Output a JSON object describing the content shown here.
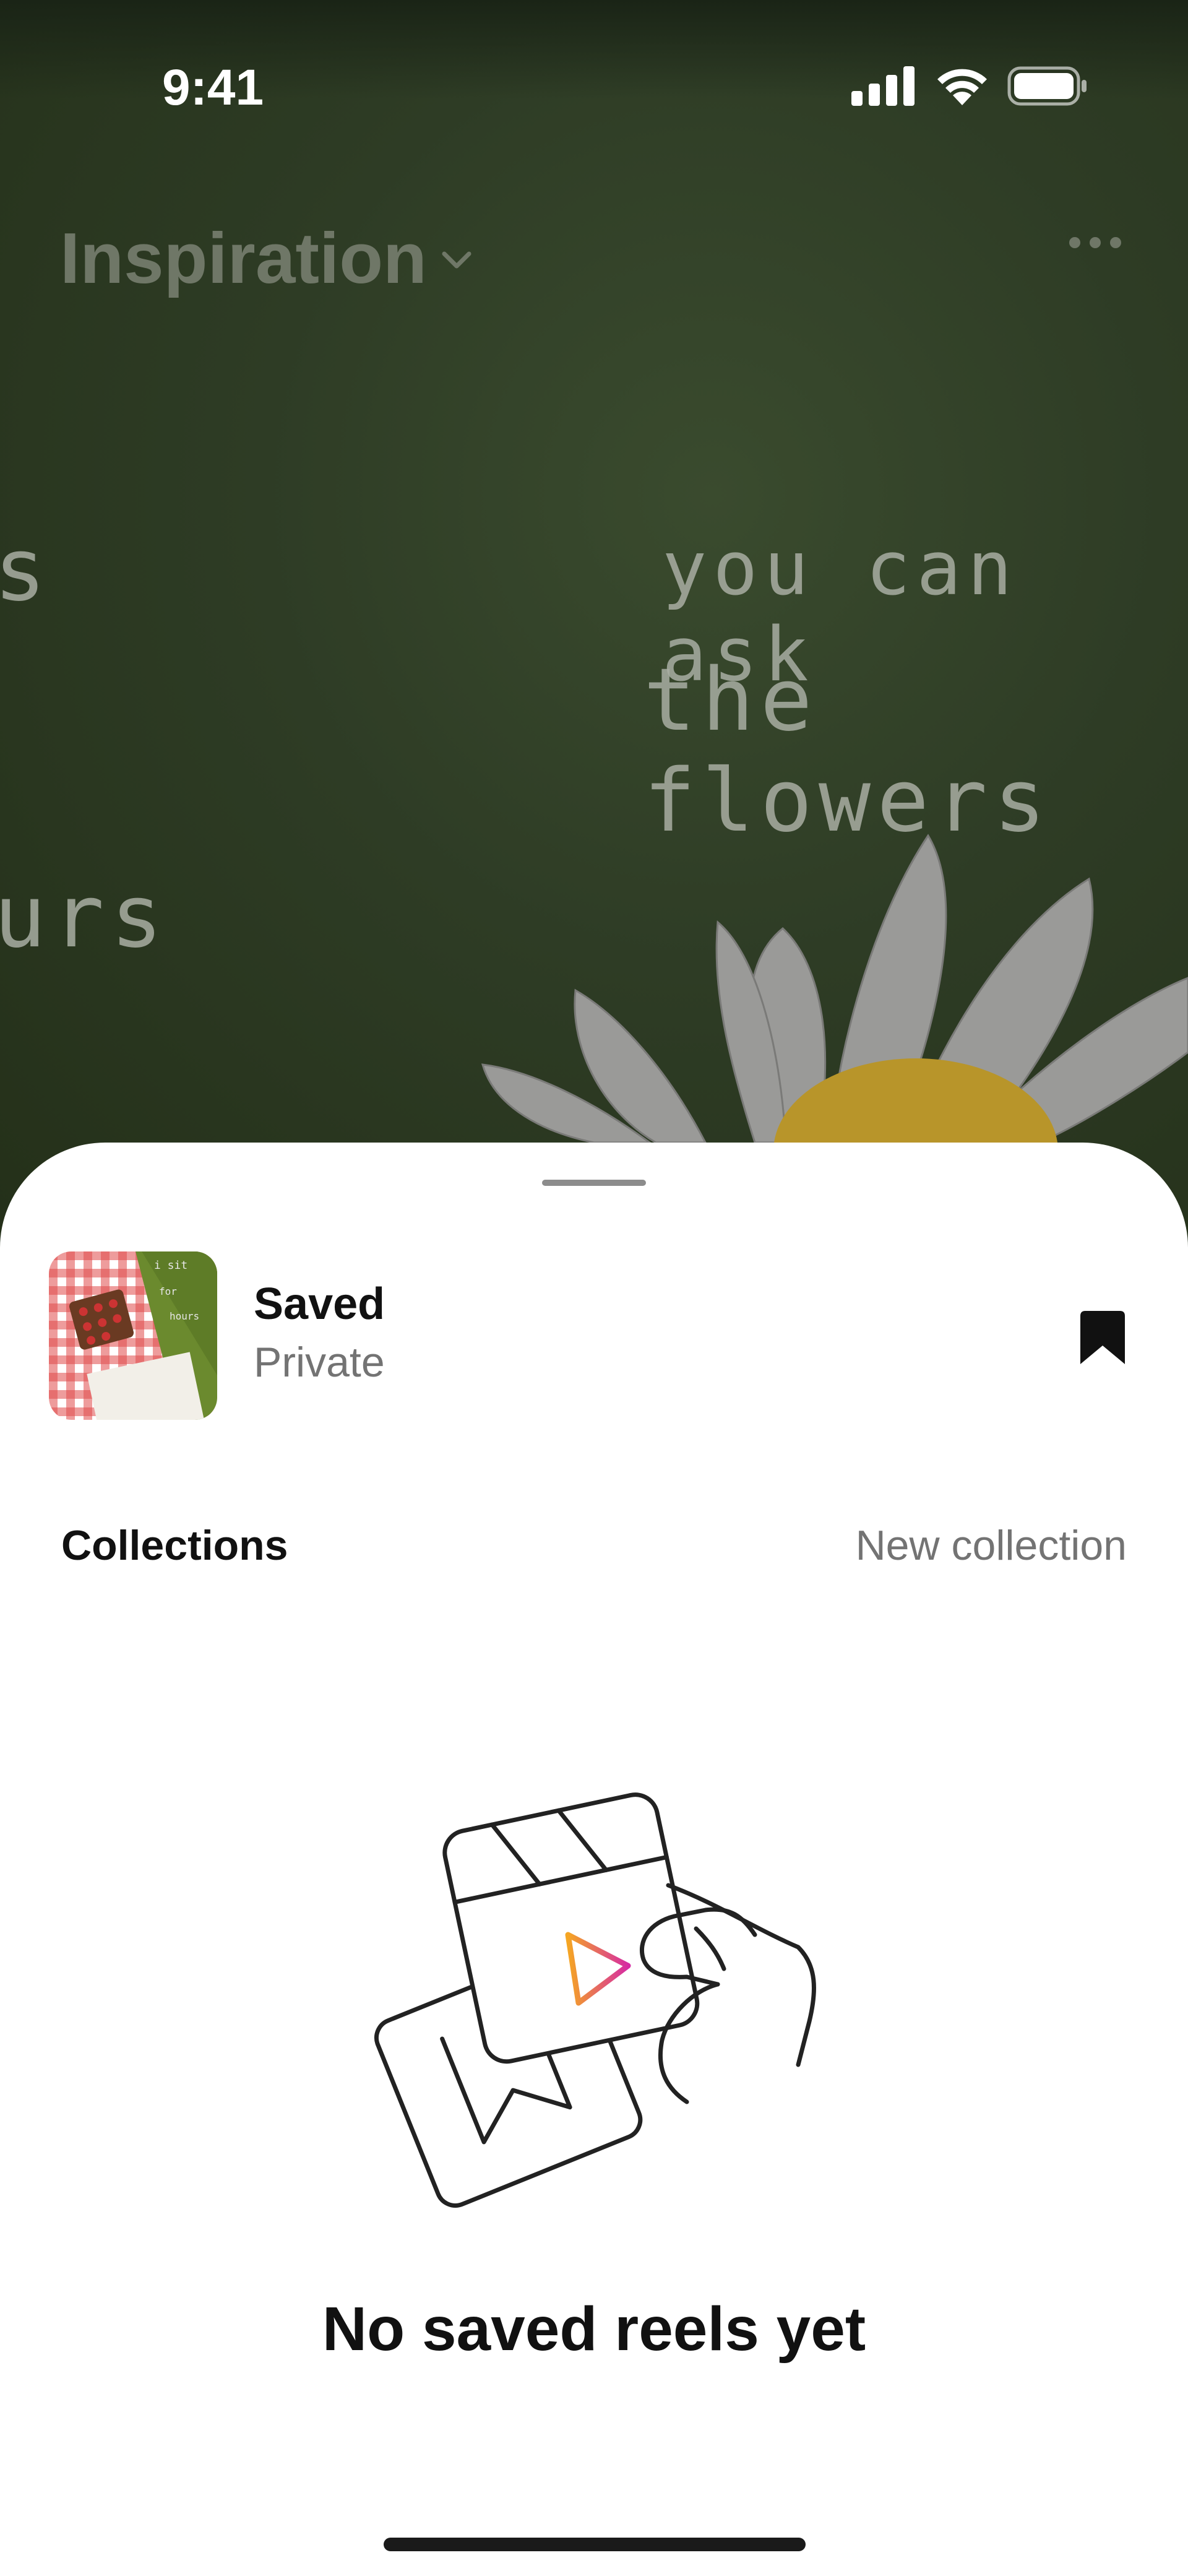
{
  "status_bar": {
    "time": "9:41"
  },
  "header": {
    "title": "Inspiration"
  },
  "background": {
    "chalk_text": [
      "you can ask",
      "the flowers",
      "urs",
      "s"
    ]
  },
  "sheet": {
    "saved": {
      "title": "Saved",
      "subtitle": "Private"
    },
    "collections_label": "Collections",
    "new_collection_label": "New collection",
    "empty_state": "No saved reels yet"
  },
  "thumbnail_text": [
    "i sit",
    "for",
    "hours"
  ],
  "colors": {
    "sheet_bg": "#ffffff",
    "muted_text": "#737373",
    "primary_text": "#111111",
    "gradient_start": "#f5a623",
    "gradient_end": "#d62ba3"
  },
  "icons": [
    "signal-icon",
    "wifi-icon",
    "battery-icon",
    "chevron-down-icon",
    "more-icon",
    "bookmark-icon",
    "reels-illustration"
  ]
}
